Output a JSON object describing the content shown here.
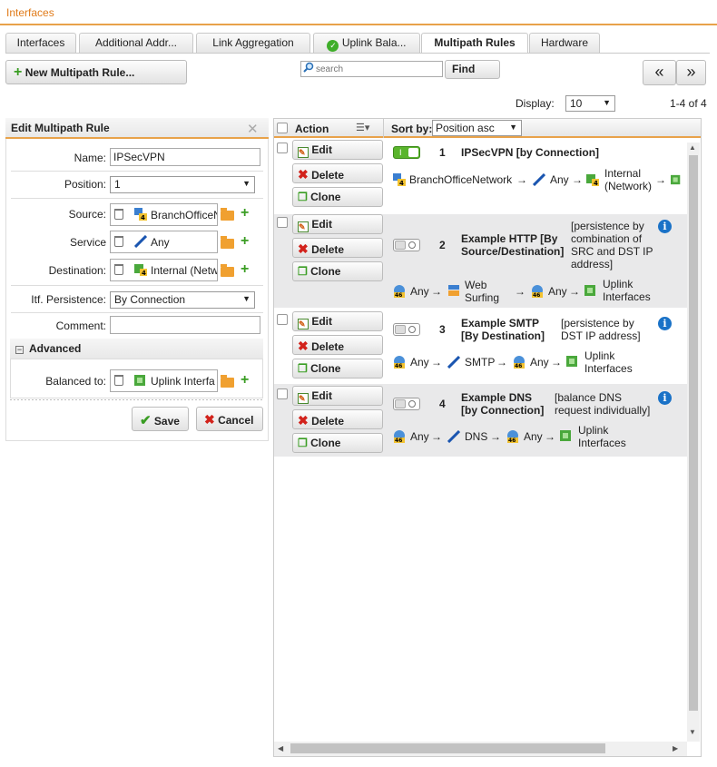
{
  "page": {
    "title": "Interfaces"
  },
  "tabs": [
    {
      "label": "Interfaces"
    },
    {
      "label": "Additional Addr..."
    },
    {
      "label": "Link Aggregation"
    },
    {
      "label": "Uplink Bala..."
    },
    {
      "label": "Multipath Rules"
    },
    {
      "label": "Hardware"
    }
  ],
  "toolbar": {
    "new_label": "New Multipath Rule...",
    "search_placeholder": "search",
    "find_label": "Find",
    "prev_label": "«",
    "next_label": "»",
    "display_label": "Display:",
    "display_value": "10",
    "paging": "1-4 of 4"
  },
  "edit_panel": {
    "title": "Edit Multipath Rule",
    "name_label": "Name:",
    "name_value": "IPSecVPN",
    "position_label": "Position:",
    "position_value": "1",
    "source_label": "Source:",
    "source_value": "BranchOfficeN",
    "service_label": "Service",
    "service_value": "Any",
    "destination_label": "Destination:",
    "destination_value": "Internal (Netw",
    "persistence_label": "Itf. Persistence:",
    "persistence_value": "By Connection",
    "comment_label": "Comment:",
    "comment_value": "",
    "advanced_label": "Advanced",
    "balanced_label": "Balanced to:",
    "balanced_value": "Uplink Interfa",
    "save_label": "Save",
    "cancel_label": "Cancel"
  },
  "grid": {
    "action_header": "Action",
    "sort_label": "Sort by:",
    "sort_value": "Position asc",
    "edit_label": "Edit",
    "delete_label": "Delete",
    "clone_label": "Clone",
    "arrow": "→",
    "rules": [
      {
        "num": "1",
        "title_line1": "IPSecVPN [by Connection]",
        "title_line2": "",
        "note": [],
        "enabled": true,
        "source": "BranchOfficeNetwork",
        "service": "Any",
        "dest_line1": "Internal",
        "dest_line2": "(Network)",
        "target_line1": "",
        "target_line2": ""
      },
      {
        "num": "2",
        "title_line1": "Example HTTP [By",
        "title_line2": "Source/Destination]",
        "note": [
          "[persistence by",
          "combination of",
          "SRC and DST IP",
          "address]"
        ],
        "enabled": false,
        "source": "Any",
        "service_line1": "Web",
        "service_line2": "Surfing",
        "dest": "Any",
        "target_line1": "Uplink",
        "target_line2": "Interfaces"
      },
      {
        "num": "3",
        "title_line1": "Example SMTP",
        "title_line2": "[By Destination]",
        "note": [
          "[persistence by",
          "DST IP address]"
        ],
        "enabled": false,
        "source": "Any",
        "service": "SMTP",
        "dest": "Any",
        "target_line1": "Uplink",
        "target_line2": "Interfaces"
      },
      {
        "num": "4",
        "title_line1": "Example DNS",
        "title_line2": "[by Connection]",
        "note": [
          "[balance DNS",
          "request individually]"
        ],
        "enabled": false,
        "source": "Any",
        "service": "DNS",
        "dest": "Any",
        "target_line1": "Uplink",
        "target_line2": "Interfaces"
      }
    ]
  },
  "colors": {
    "accent": "#e8a24a",
    "title": "#e07b1a",
    "info": "#1a72c7",
    "green": "#3a9d23",
    "red": "#d2221b"
  }
}
